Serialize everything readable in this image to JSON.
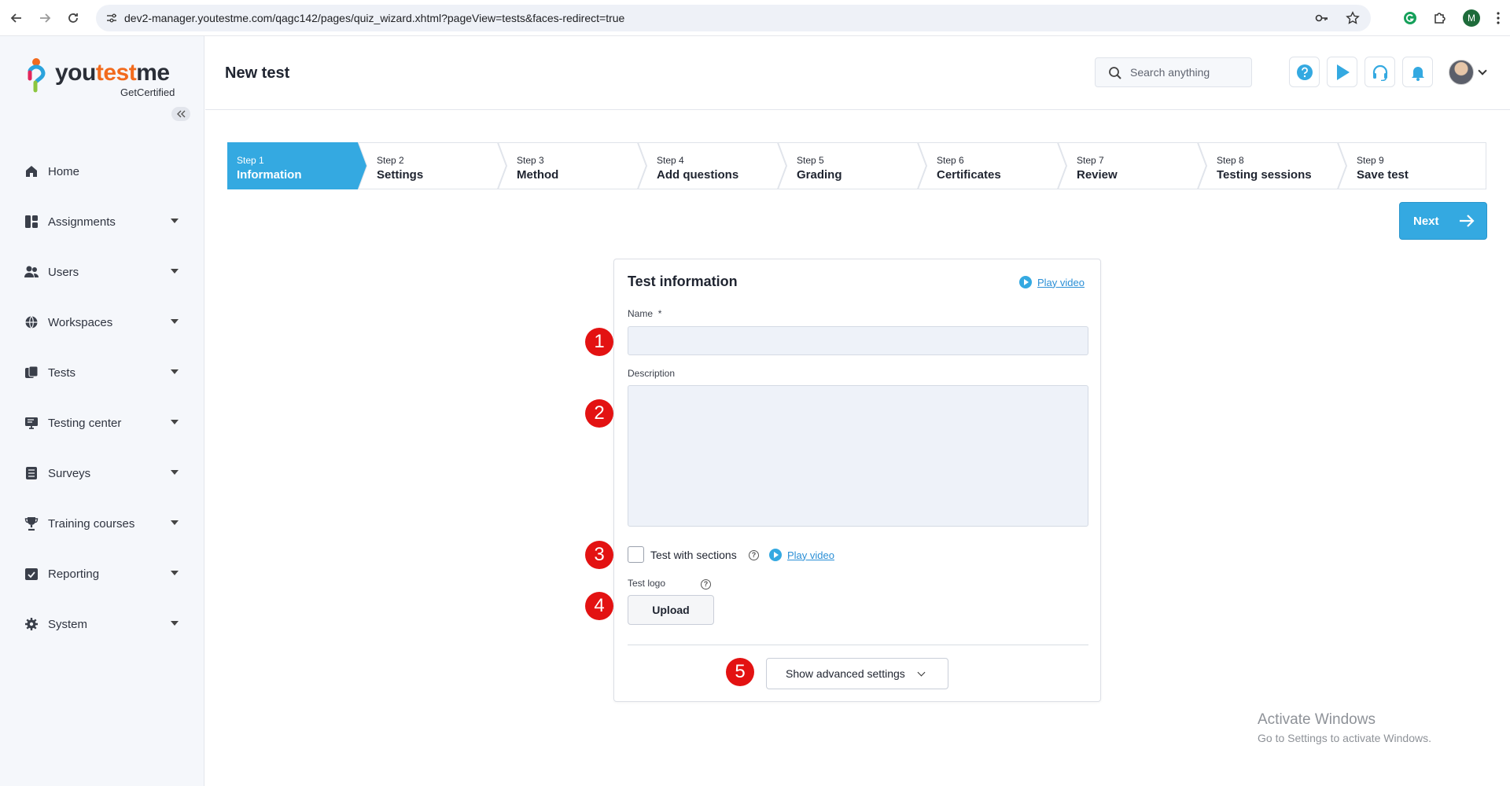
{
  "browser": {
    "url": "dev2-manager.youtestme.com/qagc142/pages/quiz_wizard.xhtml?pageView=tests&faces-redirect=true",
    "profile_initial": "M"
  },
  "logo": {
    "you": "you",
    "test": "test",
    "me": "me",
    "subtitle": "GetCertified"
  },
  "sidebar": {
    "collapse_label": "«",
    "items": [
      {
        "label": "Home",
        "icon": "home-icon",
        "has_caret": false
      },
      {
        "label": "Assignments",
        "icon": "assignments-icon",
        "has_caret": true
      },
      {
        "label": "Users",
        "icon": "users-icon",
        "has_caret": true
      },
      {
        "label": "Workspaces",
        "icon": "globe-icon",
        "has_caret": true
      },
      {
        "label": "Tests",
        "icon": "tests-icon",
        "has_caret": true
      },
      {
        "label": "Testing center",
        "icon": "monitor-icon",
        "has_caret": true
      },
      {
        "label": "Surveys",
        "icon": "surveys-icon",
        "has_caret": true
      },
      {
        "label": "Training courses",
        "icon": "trophy-icon",
        "has_caret": true
      },
      {
        "label": "Reporting",
        "icon": "reporting-icon",
        "has_caret": true
      },
      {
        "label": "System",
        "icon": "gear-icon",
        "has_caret": true
      }
    ]
  },
  "header": {
    "title": "New test",
    "search_placeholder": "Search anything"
  },
  "stepper": {
    "steps": [
      {
        "num": "Step 1",
        "name": "Information",
        "active": true
      },
      {
        "num": "Step 2",
        "name": "Settings",
        "active": false
      },
      {
        "num": "Step 3",
        "name": "Method",
        "active": false
      },
      {
        "num": "Step 4",
        "name": "Add questions",
        "active": false
      },
      {
        "num": "Step 5",
        "name": "Grading",
        "active": false
      },
      {
        "num": "Step 6",
        "name": "Certificates",
        "active": false
      },
      {
        "num": "Step 7",
        "name": "Review",
        "active": false
      },
      {
        "num": "Step 8",
        "name": "Testing sessions",
        "active": false
      },
      {
        "num": "Step 9",
        "name": "Save test",
        "active": false
      }
    ],
    "next_label": "Next"
  },
  "card": {
    "title": "Test information",
    "play_video": "Play video",
    "name_label": "Name",
    "required_mark": "*",
    "name_value": "",
    "description_label": "Description",
    "description_value": "",
    "sections_label": "Test with sections",
    "sections_checked": false,
    "sections_play_video": "Play video",
    "logo_label": "Test logo",
    "upload_label": "Upload",
    "advanced_label": "Show advanced settings"
  },
  "markers": [
    "1",
    "2",
    "3",
    "4",
    "5"
  ],
  "watermark": {
    "line1": "Activate Windows",
    "line2": "Go to Settings to activate Windows."
  },
  "colors": {
    "accent": "#34a9e1",
    "marker": "#e31212",
    "sidebar_bg": "#f5f7fb"
  }
}
